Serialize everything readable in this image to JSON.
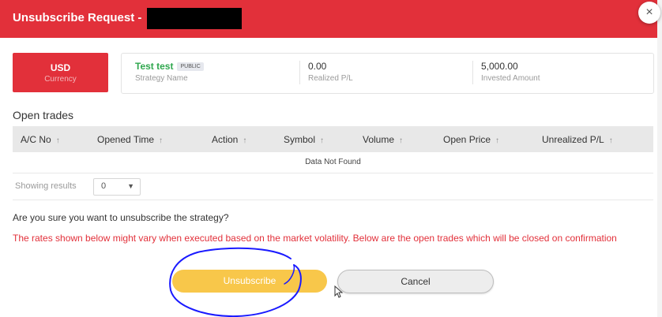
{
  "dialog": {
    "title": "Unsubscribe Request -",
    "close_glyph": "×"
  },
  "summary": {
    "currency_value": "USD",
    "currency_label": "Currency",
    "strategy_value": "Test test",
    "strategy_badge": "PUBLIC",
    "strategy_label": "Strategy Name",
    "realized_value": "0.00",
    "realized_label": "Realized P/L",
    "invested_value": "5,000.00",
    "invested_label": "Invested Amount"
  },
  "open_trades": {
    "title": "Open trades",
    "columns": [
      "A/C No",
      "Opened Time",
      "Action",
      "Symbol",
      "Volume",
      "Open Price",
      "Unrealized P/L"
    ],
    "sort_glyph": "↑",
    "empty_text": "Data Not Found",
    "showing_label": "Showing results",
    "page_size": "0"
  },
  "confirmation": {
    "question": "Are you sure you want to unsubscribe the strategy?",
    "warning": "The rates shown below might vary when executed based on the market volatility. Below are the open trades which will be closed on confirmation"
  },
  "actions": {
    "unsubscribe_label": "Unsubscribe",
    "cancel_label": "Cancel"
  },
  "colors": {
    "brand_red": "#e2303a",
    "unsubscribe_yellow": "#f8c74a",
    "strategy_green": "#2fa74e",
    "annotation_blue": "#1a1aff"
  }
}
